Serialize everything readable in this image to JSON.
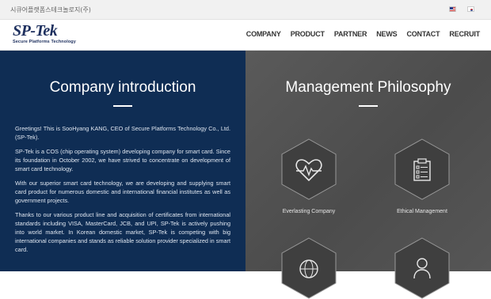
{
  "topbar": {
    "company_korean": "시큐어플랫폼스테크놀로지(주)",
    "languages": [
      "English",
      "Korean"
    ]
  },
  "header": {
    "logo_text": "SP-Tek",
    "logo_tagline": "Secure Platforms Technology",
    "nav": [
      "COMPANY",
      "PRODUCT",
      "PARTNER",
      "NEWS",
      "CONTACT",
      "RECRUIT"
    ]
  },
  "company_intro": {
    "title": "Company introduction",
    "paragraphs": [
      "Greetings! This is SooHyang KANG, CEO of Secure Platforms Technology Co., Ltd. (SP-Tek).",
      "SP-Tek is a COS (chip operating system) developing company for smart card. Since its foundation in October 2002, we have strived to concentrate on development of smart card technology.",
      "With our superior smart card technology, we are developing and supplying smart card product for numerous domestic and international financial institutes as well as government projects.",
      "Thanks to our various product line and acquisition of certificates from international standards including VISA, MasterCard, JCB, and UPI, SP-Tek is actively pushing into world market. In Korean domestic market, SP-Tek is competing with big international companies and stands as reliable solution provider specialized in smart card."
    ]
  },
  "management": {
    "title": "Management Philosophy",
    "items": [
      {
        "label": "Everlasting Company",
        "icon": "heart-monitor-icon"
      },
      {
        "label": "Ethical Management",
        "icon": "clipboard-checklist-icon"
      },
      {
        "label": "",
        "icon": "globe-icon"
      },
      {
        "label": "",
        "icon": "person-icon"
      }
    ]
  },
  "colors": {
    "navy": "#0f2d54",
    "gray_panel": "#515151",
    "logo": "#1d2f5e"
  }
}
